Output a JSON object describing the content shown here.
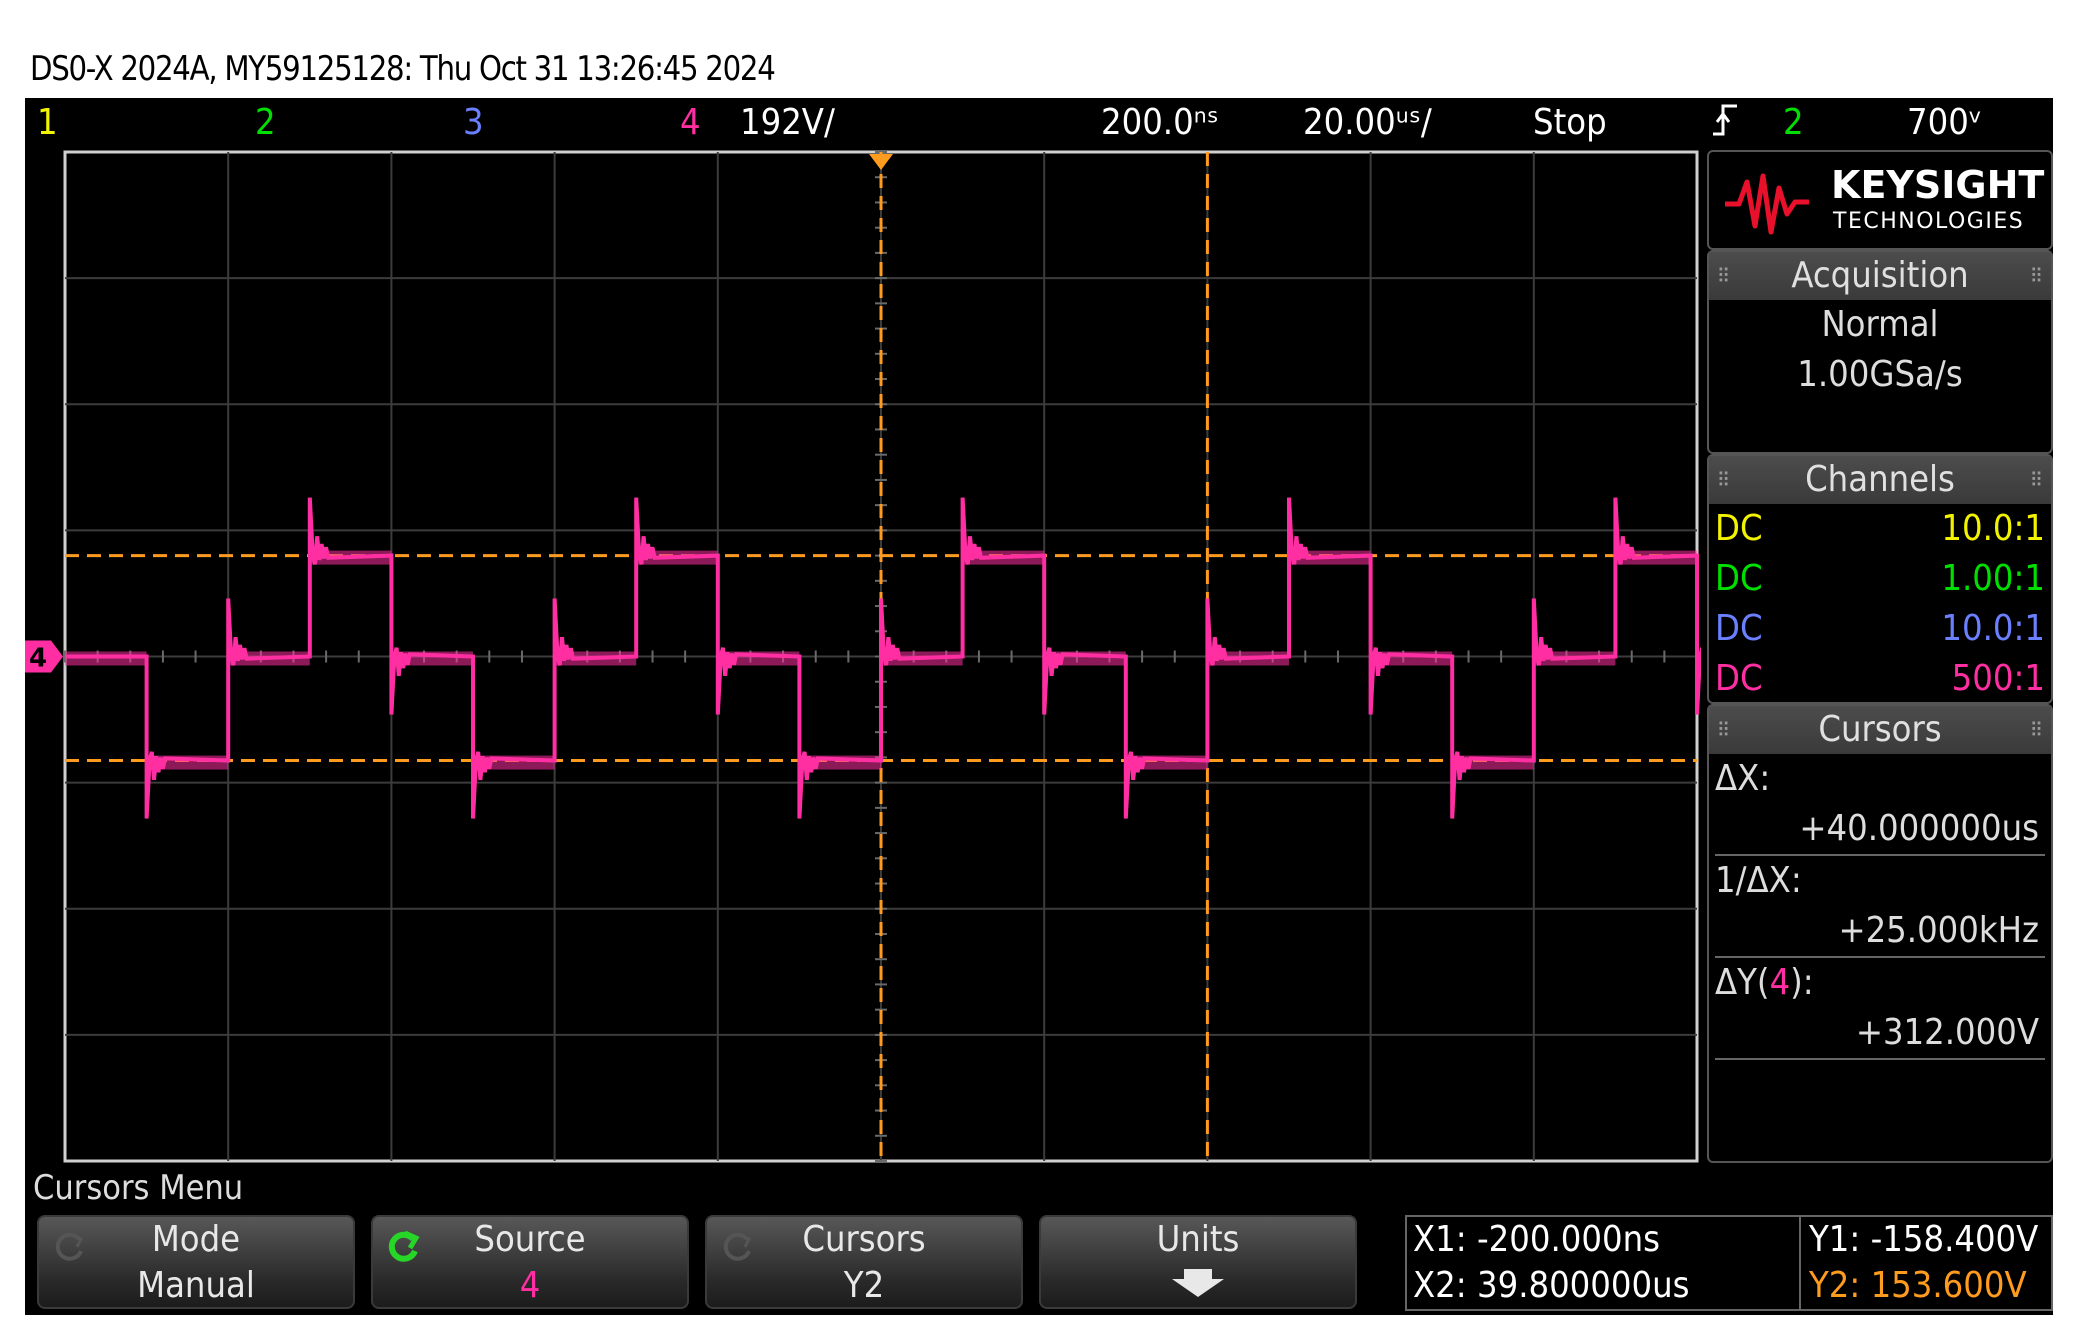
{
  "title": "DS0-X 2024A, MY59125128: Thu Oct 31 13:26:45 2024",
  "status": {
    "ch1": "1",
    "ch2": "2",
    "ch3": "3",
    "ch4": "4",
    "ch4_scale": "192V/",
    "delay": "200.0ⁿˢ",
    "timebase": "20.00ᵘˢ/",
    "run_state": "Stop",
    "trigger_icon": "rising-edge-icon",
    "trigger_channel": "2",
    "trigger_level": "700ᵛ"
  },
  "channel_marker": "4",
  "logo": {
    "brand": "KEYSIGHT",
    "sub": "TECHNOLOGIES"
  },
  "acquisition": {
    "header": "Acquisition",
    "mode": "Normal",
    "rate": "1.00GSa/s"
  },
  "channels": {
    "header": "Channels",
    "rows": [
      {
        "coupling": "DC",
        "probe": "10.0:1",
        "color": "#f3f300"
      },
      {
        "coupling": "DC",
        "probe": "1.00:1",
        "color": "#00e000"
      },
      {
        "coupling": "DC",
        "probe": "10.0:1",
        "color": "#6a80ff"
      },
      {
        "coupling": "DC",
        "probe": "500:1",
        "color": "#ff2fa3"
      }
    ]
  },
  "cursors": {
    "header": "Cursors",
    "dx_label": "ΔX:",
    "dx_value": "+40.000000us",
    "inv_label": "1/ΔX:",
    "inv_value": "+25.000kHz",
    "dy_label_pre": "ΔY(",
    "dy_label_ch": "4",
    "dy_label_post": "):",
    "dy_value": "+312.000V"
  },
  "menu": {
    "title": "Cursors Menu",
    "softkeys": [
      {
        "label": "Mode",
        "value": "Manual"
      },
      {
        "label": "Source",
        "value": "4"
      },
      {
        "label": "Cursors",
        "value": "Y2"
      },
      {
        "label": "Units",
        "value": ""
      }
    ],
    "readout": {
      "x1": "X1: -200.000ns",
      "x2": "X2: 39.800000us",
      "y1": "Y1: -158.400V",
      "y2": "Y2: 153.600V"
    }
  },
  "colors": {
    "ch1": "#f3f300",
    "ch2": "#00e000",
    "ch3": "#6a80ff",
    "ch4": "#ff2fa3",
    "cursor": "#ff9b1e"
  },
  "waveform": {
    "channel": "4",
    "description_units": "volts vs time",
    "volts_per_div": 192,
    "time_per_div_us": 20,
    "levels_volts": [
      0,
      153.6,
      0,
      -158.4,
      0
    ],
    "period_us": 40,
    "cursor_x1_us": -0.2,
    "cursor_x2_us": 39.8,
    "cursor_y1_v": -158.4,
    "cursor_y2_v": 153.6
  }
}
